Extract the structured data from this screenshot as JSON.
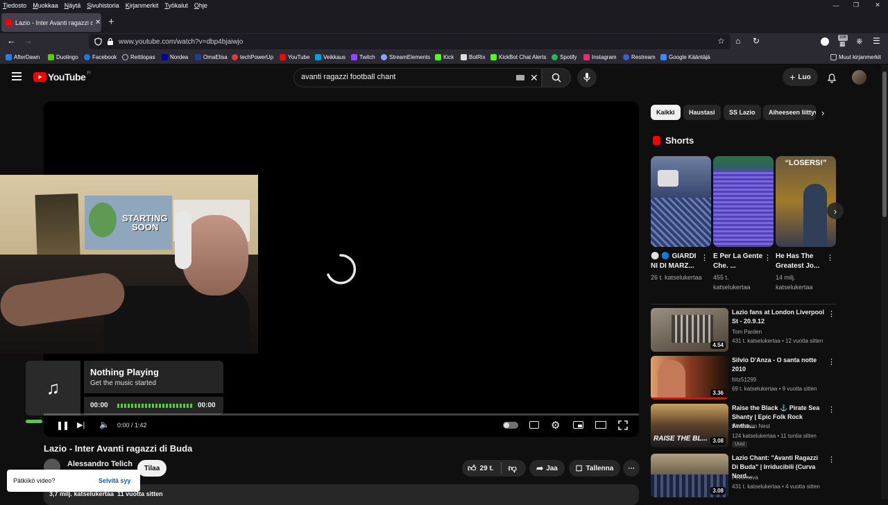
{
  "menubar": {
    "items": [
      "Tiedosto",
      "Muokkaa",
      "Näytä",
      "Sivuhistoria",
      "Kirjanmerkit",
      "Työkalut",
      "Ohje"
    ]
  },
  "tab": {
    "title": "Lazio - Inter Avanti ragazzi di Buda"
  },
  "navbar": {
    "url": "www.youtube.com/watch?v=dbp4bjaiwjo",
    "extension_badge": "336"
  },
  "bookmarks": [
    {
      "label": "AfterDawn",
      "color": "#2e7dd7"
    },
    {
      "label": "Duolingo",
      "color": "#58cc02"
    },
    {
      "label": "Facebook",
      "color": "#1877f2"
    },
    {
      "label": "Reittiopas",
      "color": "#cccccc"
    },
    {
      "label": "Nordea",
      "color": "#0000a0"
    },
    {
      "label": "OmaElisa",
      "color": "#1c3f94"
    },
    {
      "label": "techPowerUp",
      "color": "#e53935"
    },
    {
      "label": "YouTube",
      "color": "#ff0000"
    },
    {
      "label": "Veikkaus",
      "color": "#00a0e0"
    },
    {
      "label": "Twitch",
      "color": "#9146ff"
    },
    {
      "label": "StreamElements",
      "color": "#8aa2ff"
    },
    {
      "label": "Kick",
      "color": "#53fc18"
    },
    {
      "label": "BotRix",
      "color": "#dddddd"
    },
    {
      "label": "KickBot Chat Alerts",
      "color": "#53fc18"
    },
    {
      "label": "Spotify",
      "color": "#1db954"
    },
    {
      "label": "Instagram",
      "color": "#e1306c"
    },
    {
      "label": "Restream",
      "color": "#3b5bdb"
    },
    {
      "label": "Google Kääntäjä",
      "color": "#4285f4"
    }
  ],
  "bookmarks_other": "Muut kirjanmerkit",
  "youtube": {
    "logo_text": "YouTube",
    "region": "FI",
    "search_value": "avanti ragazzi football chant",
    "create_label": "Luo"
  },
  "overlay": {
    "webcam_poster_line1": "STARTING",
    "webcam_poster_line2": "SOON",
    "np_title": "Nothing Playing",
    "np_subtitle": "Get the music started",
    "np_time_start": "00:00",
    "np_time_end": "00:00"
  },
  "player": {
    "time": "0:00 / 1:42"
  },
  "video": {
    "title": "Lazio - Inter Avanti ragazzi di Buda",
    "channel": "Alessandro Telich",
    "subscribe": "Tilaa",
    "likes": "29 t.",
    "share": "Jaa",
    "save": "Tallenna",
    "meta": "3,7 milj. katselukertaa  11 vuotta sitten"
  },
  "toast": {
    "question": "Pätkiikö video?",
    "action": "Selvitä syy"
  },
  "chips": [
    "Kaikki",
    "Haustasi",
    "SS Lazio",
    "Aiheeseen liittyvät"
  ],
  "shorts_heading": "Shorts",
  "shorts": [
    {
      "title": "⚪ 🔵 GIARDI NI DI MARZ...",
      "views": "26 t. katselukertaa",
      "color": "#3b4f86"
    },
    {
      "title": "E Per La Gente Che. ...",
      "views": "455 t. katselukertaa",
      "color": "#5b3fb0"
    },
    {
      "title": "He Has The Greatest Jo...",
      "views": "14 milj. katselukertaa",
      "overlay_text": "“LOSERS!”",
      "color": "#8a6a2a"
    }
  ],
  "recommendations": [
    {
      "title": "Lazio fans at London Liverpool St - 20.9.12",
      "channel": "Tom Parden",
      "meta": "431 t. katselukertaa • 12 vuotta sitten",
      "duration": "4.54",
      "color": "#7a7060"
    },
    {
      "title": "Silvio D'Anza - O santa notte 2010",
      "channel": "fritz51299",
      "meta": "69 t. katselukertaa • 9 vuotta sitten",
      "duration": "3.36",
      "color": "#b05a30",
      "progress": 1.0
    },
    {
      "title": "Raise the Black ⚓ Pirate Sea Shanty | Epic Folk Rock Anthe...",
      "channel": "Waveform Nest",
      "meta": "124 katselukertaa • 11 tuntia sitten",
      "badge": "Uusi",
      "duration": "3.08",
      "thumb_text": "RAISE THE BL...",
      "color": "#5a4a35"
    },
    {
      "title": "Lazio Chant: \"Avanti Ragazzi Di Buda\" | Irriducibili (Curva Nord...",
      "channel": "Fevernova",
      "meta": "431 t. katselukertaa • 4 vuotta sitten",
      "duration": "3.08",
      "color": "#6a6258"
    }
  ]
}
